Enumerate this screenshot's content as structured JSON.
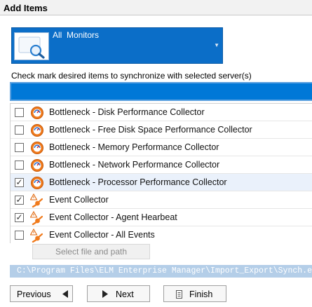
{
  "header": {
    "title": "Add Items"
  },
  "monitor_select": {
    "value": "All  Monitors",
    "icon": "magnifier-monitor-icon"
  },
  "instruction": "Check mark desired items to synchronize with selected server(s)",
  "filter": {
    "value": "",
    "placeholder": ""
  },
  "items": [
    {
      "label": "Bottleneck - Disk Performance Collector",
      "checked": false,
      "icon": "performance-collector-icon"
    },
    {
      "label": "Bottleneck - Free Disk Space Performance Collector",
      "checked": false,
      "icon": "performance-collector-icon"
    },
    {
      "label": "Bottleneck - Memory Performance Collector",
      "checked": false,
      "icon": "performance-collector-icon"
    },
    {
      "label": "Bottleneck - Network Performance Collector",
      "checked": false,
      "icon": "performance-collector-icon"
    },
    {
      "label": "Bottleneck - Processor Performance Collector",
      "checked": true,
      "selected": true,
      "icon": "performance-collector-icon"
    },
    {
      "label": "Event Collector",
      "checked": true,
      "icon": "event-collector-icon"
    },
    {
      "label": "Event Collector - Agent Hearbeat",
      "checked": true,
      "icon": "event-collector-icon"
    },
    {
      "label": "Event Collector - All Events",
      "checked": false,
      "icon": "event-collector-icon"
    }
  ],
  "select_file_button": "Select file and path",
  "file_path": "C:\\Program Files\\ELM Enterprise Manager\\Import_Export\\Synch.elx",
  "buttons": {
    "previous": "Previous",
    "next": "Next",
    "finish": "Finish"
  },
  "colors": {
    "accent": "#0078d7",
    "dropdown": "#0b6ec8",
    "path_bar": "#b4cee8",
    "icon_orange": "#f07a1c"
  }
}
